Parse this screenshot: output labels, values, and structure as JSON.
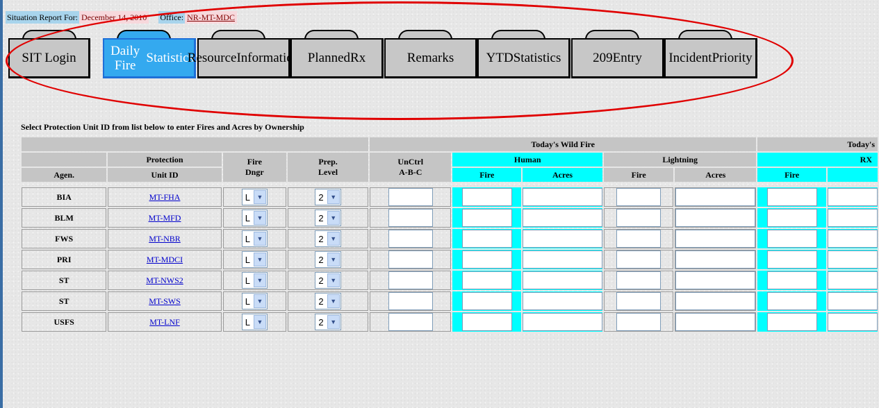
{
  "header": {
    "situation_label": "Situation Report For:",
    "date": "December 14, 2010",
    "office_label": "Office:",
    "office": "NR-MT-MDC"
  },
  "tabs": [
    {
      "line1": "SIT Login",
      "line2": "",
      "active": false
    },
    {
      "line1": "Daily Fire",
      "line2": "Statistics",
      "active": true
    },
    {
      "line1": "Resource",
      "line2": "Information",
      "active": false
    },
    {
      "line1": "Planned",
      "line2": "Rx",
      "active": false
    },
    {
      "line1": "Remarks",
      "line2": "",
      "active": false
    },
    {
      "line1": "YTD",
      "line2": "Statistics",
      "active": false
    },
    {
      "line1": "209",
      "line2": "Entry",
      "active": false
    },
    {
      "line1": "Incident",
      "line2": "Priority",
      "active": false
    }
  ],
  "annotation_color": "#e00000",
  "caption": "Select Protection Unit ID from list below to enter Fires and Acres by Ownership",
  "table": {
    "group_wildfire": "Today's Wild Fire",
    "group_rx": "Today's",
    "protection_top": "Protection",
    "agen": "Agen.",
    "unit_id": "Unit ID",
    "fire_dngr": [
      "Fire",
      "Dngr"
    ],
    "prep_level": [
      "Prep.",
      "Level"
    ],
    "unctrl": [
      "UnCtrl",
      "A-B-C"
    ],
    "human": "Human",
    "lightning": "Lightning",
    "rx": "RX",
    "fire": "Fire",
    "acres": "Acres",
    "rows": [
      {
        "agency": "BIA",
        "unit": "MT-FHA",
        "danger": "L",
        "prep": "2"
      },
      {
        "agency": "BLM",
        "unit": "MT-MFD",
        "danger": "L",
        "prep": "2"
      },
      {
        "agency": "FWS",
        "unit": "MT-NBR",
        "danger": "L",
        "prep": "2"
      },
      {
        "agency": "PRI",
        "unit": "MT-MDCI",
        "danger": "L",
        "prep": "2"
      },
      {
        "agency": "ST",
        "unit": "MT-NWS2",
        "danger": "L",
        "prep": "2"
      },
      {
        "agency": "ST",
        "unit": "MT-SWS",
        "danger": "L",
        "prep": "2"
      },
      {
        "agency": "USFS",
        "unit": "MT-LNF",
        "danger": "L",
        "prep": "2"
      }
    ]
  }
}
